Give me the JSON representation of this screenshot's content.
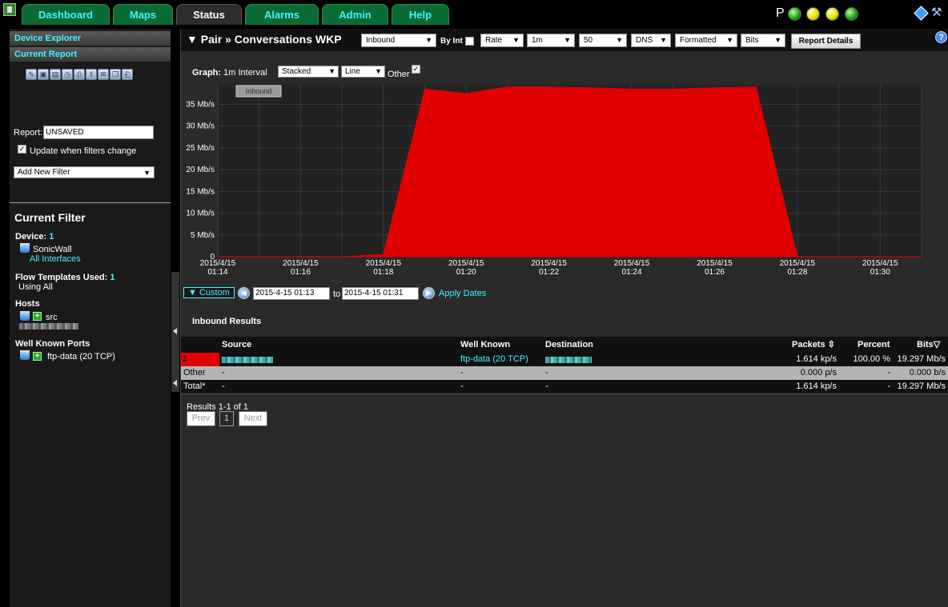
{
  "nav": {
    "tabs": [
      {
        "label": "Dashboard"
      },
      {
        "label": "Maps"
      },
      {
        "label": "Status"
      },
      {
        "label": "Alarms"
      },
      {
        "label": "Admin"
      },
      {
        "label": "Help"
      }
    ],
    "active_tab": "Status",
    "status_letter": "P",
    "status_colors": {
      "green": "#22a51d",
      "yellow": "#e8e00a"
    }
  },
  "sidebar": {
    "device_explorer": "Device Explorer",
    "current_report": "Current Report",
    "report_label": "Report:",
    "report_value": "UNSAVED",
    "update_label": "Update when filters change",
    "add_filter": "Add New Filter",
    "current_filter_title": "Current Filter",
    "device_label": "Device:",
    "device_count": "1",
    "device_name": "SonicWall",
    "device_interfaces": "All Interfaces",
    "flow_label": "Flow Templates Used:",
    "flow_count": "1",
    "flow_value": "Using All",
    "hosts_label": "Hosts",
    "hosts_value": "src",
    "wkp_label": "Well Known Ports",
    "wkp_value": "ftp-data (20 TCP)"
  },
  "header": {
    "title": "▼ Pair » Conversations WKP",
    "direction": "Inbound",
    "by_int": "By Int",
    "rate": "Rate",
    "interval": "1m",
    "count": "50",
    "dns": "DNS",
    "format": "Formatted",
    "units": "Bits",
    "report_details": "Report Details"
  },
  "graph": {
    "label": "Graph:",
    "interval_text": "1m Interval",
    "mode": "Stacked",
    "style": "Line",
    "other": "Other"
  },
  "chart_data": {
    "type": "area",
    "series": [
      {
        "name": "Inbound",
        "color": "#e10000"
      }
    ],
    "x": [
      "01:14",
      "01:15",
      "01:16",
      "01:17",
      "01:18",
      "01:19",
      "01:20",
      "01:21",
      "01:22",
      "01:23",
      "01:24",
      "01:25",
      "01:26",
      "01:27",
      "01:28",
      "01:29",
      "01:30",
      "01:31"
    ],
    "values_mbps": [
      0,
      0,
      0,
      0,
      0.5,
      38.5,
      37.5,
      39,
      39,
      38.8,
      38.5,
      38.5,
      38.8,
      39,
      0,
      0,
      0,
      0
    ],
    "y_ticks": [
      "0",
      "5 Mb/s",
      "10 Mb/s",
      "15 Mb/s",
      "20 Mb/s",
      "25 Mb/s",
      "30 Mb/s",
      "35 Mb/s"
    ],
    "ylim": [
      0,
      39.5
    ],
    "x_ticks": [
      {
        "date": "2015/4/15",
        "time": "01:14"
      },
      {
        "date": "2015/4/15",
        "time": "01:16"
      },
      {
        "date": "2015/4/15",
        "time": "01:18"
      },
      {
        "date": "2015/4/15",
        "time": "01:20"
      },
      {
        "date": "2015/4/15",
        "time": "01:22"
      },
      {
        "date": "2015/4/15",
        "time": "01:24"
      },
      {
        "date": "2015/4/15",
        "time": "01:26"
      },
      {
        "date": "2015/4/15",
        "time": "01:28"
      },
      {
        "date": "2015/4/15",
        "time": "01:30"
      }
    ],
    "grid": true,
    "legend_label": "Inbound"
  },
  "dates": {
    "custom": "▼ Custom",
    "from": "2015-4-15 01:13",
    "to_label": "to",
    "to": "2015-4-15 01:31",
    "apply": "Apply Dates"
  },
  "results": {
    "title": "Inbound Results",
    "columns": [
      "Source",
      "Well Known",
      "Destination",
      "Packets",
      "Percent",
      "Bits"
    ],
    "rows": [
      {
        "index": "1",
        "source": "",
        "well_known": "ftp-data (20 TCP)",
        "destination": "",
        "packets": "1.614 kp/s",
        "percent": "100.00 %",
        "bits": "19.297 Mb/s"
      }
    ],
    "other": {
      "label": "Other",
      "source": "-",
      "well_known": "-",
      "destination": "-",
      "packets": "0.000 p/s",
      "percent": "-",
      "bits": "0.000 b/s"
    },
    "total": {
      "label": "Total*",
      "source": "-",
      "well_known": "-",
      "destination": "-",
      "packets": "1.614 kp/s",
      "percent": "-",
      "bits": "19.297 Mb/s"
    },
    "count_text": "Results 1-1 of 1",
    "prev": "Prev",
    "page": "1",
    "next": "Next"
  }
}
